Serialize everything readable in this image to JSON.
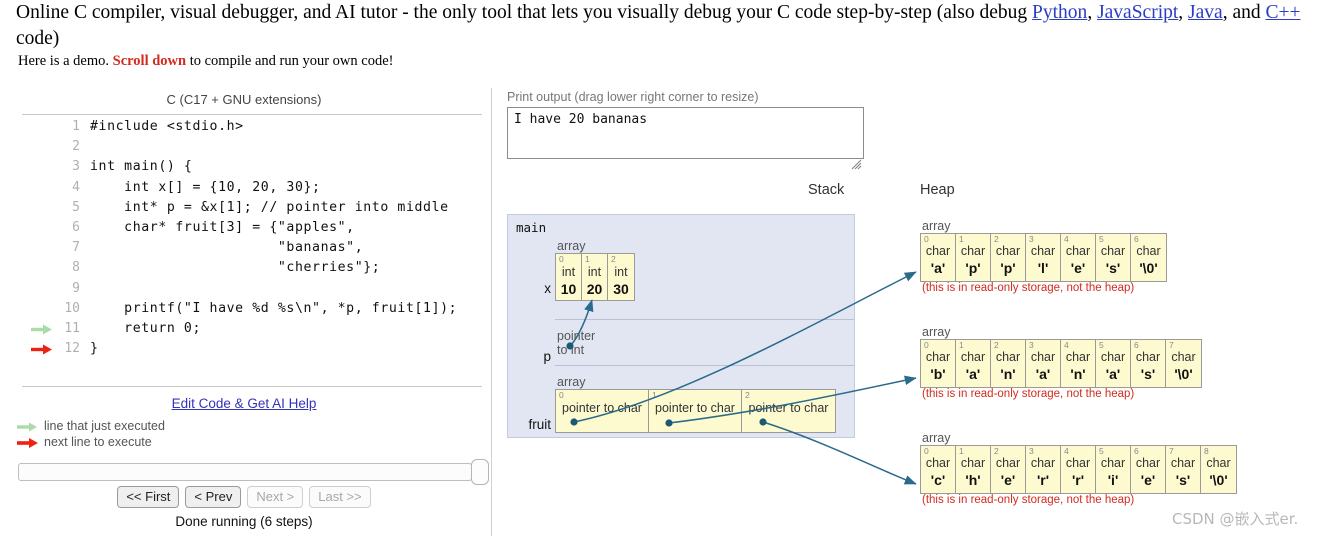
{
  "header": {
    "part1": "Online C compiler, visual debugger, and AI tutor - the only tool that lets you visually debug your C code step-by-step (also debug ",
    "link_python": "Python",
    "sep1": ", ",
    "link_javascript": "JavaScript",
    "sep2": ", ",
    "link_java": "Java",
    "sep3": ", and ",
    "link_cpp": "C++",
    "part_end": " code)",
    "demo_pre": "Here is a demo. ",
    "demo_scroll": "Scroll down",
    "demo_post": " to compile and run your own code!"
  },
  "code_panel": {
    "title": "C (C17 + GNU extensions)",
    "lines": [
      {
        "n": "1",
        "text": "#include <stdio.h>",
        "marker": "none"
      },
      {
        "n": "2",
        "text": "",
        "marker": "none"
      },
      {
        "n": "3",
        "text": "int main() {",
        "marker": "none"
      },
      {
        "n": "4",
        "text": "    int x[] = {10, 20, 30};",
        "marker": "none"
      },
      {
        "n": "5",
        "text": "    int* p = &x[1]; // pointer into middle",
        "marker": "none"
      },
      {
        "n": "6",
        "text": "    char* fruit[3] = {\"apples\",",
        "marker": "none"
      },
      {
        "n": "7",
        "text": "                      \"bananas\",",
        "marker": "none"
      },
      {
        "n": "8",
        "text": "                      \"cherries\"};",
        "marker": "none"
      },
      {
        "n": "9",
        "text": "",
        "marker": "none"
      },
      {
        "n": "10",
        "text": "    printf(\"I have %d %s\\n\", *p, fruit[1]);",
        "marker": "none"
      },
      {
        "n": "11",
        "text": "    return 0;",
        "marker": "green"
      },
      {
        "n": "12",
        "text": "}",
        "marker": "red"
      }
    ],
    "edit_link": "Edit Code & Get AI Help",
    "legend_green": "line that just executed",
    "legend_red": "next line to execute",
    "buttons": [
      {
        "label": "<< First",
        "disabled": false
      },
      {
        "label": "< Prev",
        "disabled": false
      },
      {
        "label": "Next >",
        "disabled": true
      },
      {
        "label": "Last >>",
        "disabled": true
      }
    ],
    "status": "Done running (6 steps)"
  },
  "print_output": {
    "label": "Print output (drag lower right corner to resize)",
    "text": "I have 20 bananas"
  },
  "stack": {
    "label": "Stack",
    "frame_name": "main",
    "vars": [
      {
        "name": "x",
        "kind": "array",
        "kind_label": "array",
        "cells": [
          {
            "i": "0",
            "type": "int",
            "value": "10"
          },
          {
            "i": "1",
            "type": "int",
            "value": "20"
          },
          {
            "i": "2",
            "type": "int",
            "value": "30"
          }
        ]
      },
      {
        "name": "p",
        "kind": "pointer",
        "kind_label": "pointer to int",
        "cells": []
      },
      {
        "name": "fruit",
        "kind": "array",
        "kind_label": "array",
        "cells": [
          {
            "i": "0",
            "type": "pointer to char",
            "value": ""
          },
          {
            "i": "1",
            "type": "pointer to char",
            "value": ""
          },
          {
            "i": "2",
            "type": "pointer to char",
            "value": ""
          }
        ]
      }
    ]
  },
  "heap": {
    "label": "Heap",
    "readonly_note": "(this is in read-only storage, not the heap)",
    "arrays": [
      {
        "kind_label": "array",
        "cells": [
          {
            "i": "0",
            "type": "char",
            "value": "'a'"
          },
          {
            "i": "1",
            "type": "char",
            "value": "'p'"
          },
          {
            "i": "2",
            "type": "char",
            "value": "'p'"
          },
          {
            "i": "3",
            "type": "char",
            "value": "'l'"
          },
          {
            "i": "4",
            "type": "char",
            "value": "'e'"
          },
          {
            "i": "5",
            "type": "char",
            "value": "'s'"
          },
          {
            "i": "6",
            "type": "char",
            "value": "'\\0'"
          }
        ]
      },
      {
        "kind_label": "array",
        "cells": [
          {
            "i": "0",
            "type": "char",
            "value": "'b'"
          },
          {
            "i": "1",
            "type": "char",
            "value": "'a'"
          },
          {
            "i": "2",
            "type": "char",
            "value": "'n'"
          },
          {
            "i": "3",
            "type": "char",
            "value": "'a'"
          },
          {
            "i": "4",
            "type": "char",
            "value": "'n'"
          },
          {
            "i": "5",
            "type": "char",
            "value": "'a'"
          },
          {
            "i": "6",
            "type": "char",
            "value": "'s'"
          },
          {
            "i": "7",
            "type": "char",
            "value": "'\\0'"
          }
        ]
      },
      {
        "kind_label": "array",
        "cells": [
          {
            "i": "0",
            "type": "char",
            "value": "'c'"
          },
          {
            "i": "1",
            "type": "char",
            "value": "'h'"
          },
          {
            "i": "2",
            "type": "char",
            "value": "'e'"
          },
          {
            "i": "3",
            "type": "char",
            "value": "'r'"
          },
          {
            "i": "4",
            "type": "char",
            "value": "'r'"
          },
          {
            "i": "5",
            "type": "char",
            "value": "'i'"
          },
          {
            "i": "6",
            "type": "char",
            "value": "'e'"
          },
          {
            "i": "7",
            "type": "char",
            "value": "'s'"
          },
          {
            "i": "8",
            "type": "char",
            "value": "'\\0'"
          }
        ]
      }
    ]
  },
  "watermark": "CSDN @嵌入式er.",
  "colors": {
    "link": "#2a3cc4",
    "accent_red": "#d22b1e",
    "stack_bg": "#e1e6f2",
    "cell_yellow": "#fdfad0",
    "arrow": "#2a6a8a"
  }
}
